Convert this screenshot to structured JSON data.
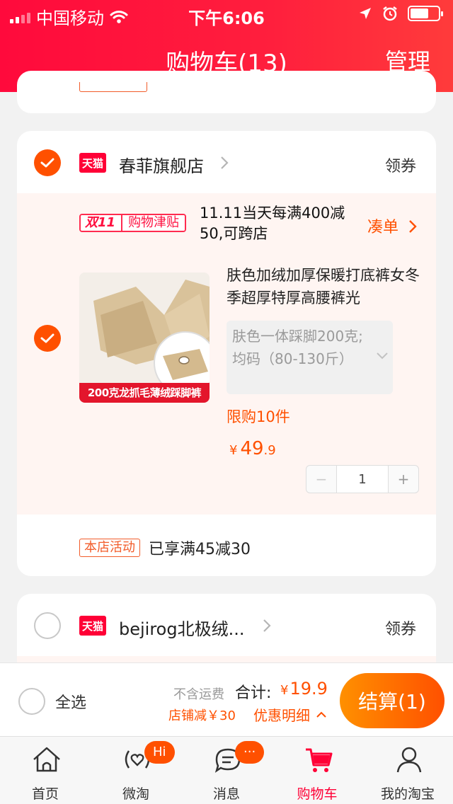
{
  "status_bar": {
    "carrier": "中国移动",
    "time": "下午6:06"
  },
  "nav": {
    "title": "购物车(13)",
    "manage": "管理"
  },
  "store": {
    "name": "春菲旗舰店",
    "mall_badge": "天猫",
    "coupon": "领券",
    "promo": {
      "badge_event": "双11",
      "badge_label": "购物津贴",
      "text": "11.11当天每满400减50,可跨店",
      "action": "凑单"
    },
    "item": {
      "title": "肤色加绒加厚保暖打底裤女冬季超厚特厚高腰裤光",
      "thumb_banner": "200克龙抓毛薄绒踩脚裤",
      "sku": "肤色一体踩脚200克;均码（80-130斤）",
      "limit": "限购10件",
      "currency": "¥",
      "price_int": "49",
      "price_dec": ".9",
      "qty_minus": "−",
      "quantity": "1",
      "qty_plus": "+",
      "checked": true
    },
    "activity": {
      "tag": "本店活动",
      "text": "已享满45减30"
    }
  },
  "store2": {
    "name": "bejirog北极绒...",
    "mall_badge": "天猫",
    "coupon": "领券",
    "checked": false
  },
  "footer": {
    "select_all": "全选",
    "shipping_note": "不含运费",
    "total_label": "合计:",
    "currency": "¥",
    "total_value": "19.9",
    "shop_discount": "店铺减￥30",
    "detail": "优惠明细",
    "checkout": "结算(1)"
  },
  "tabbar": {
    "tabs": [
      {
        "label": "首页",
        "icon": "home-icon"
      },
      {
        "label": "微淘",
        "icon": "weitao-icon",
        "badge": "Hi"
      },
      {
        "label": "消息",
        "icon": "message-icon",
        "badge": "···"
      },
      {
        "label": "购物车",
        "icon": "cart-icon",
        "active": true
      },
      {
        "label": "我的淘宝",
        "icon": "profile-icon"
      }
    ]
  },
  "colors": {
    "brand_red": "#ff0036",
    "accent_orange": "#ff5000"
  }
}
